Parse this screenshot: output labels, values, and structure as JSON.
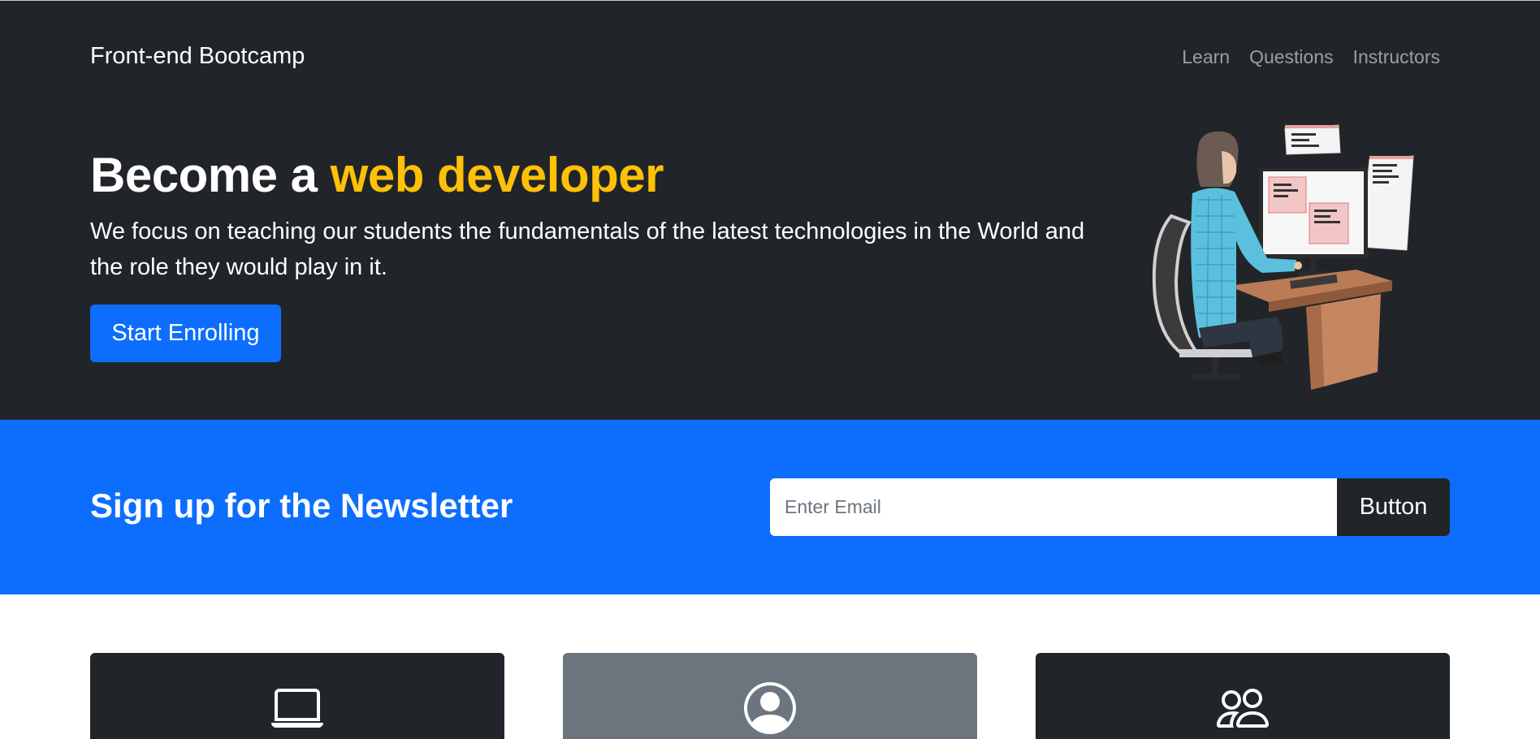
{
  "navbar": {
    "brand": "Front-end Bootcamp",
    "links": [
      {
        "label": "Learn"
      },
      {
        "label": "Questions"
      },
      {
        "label": "Instructors"
      }
    ]
  },
  "hero": {
    "title_prefix": "Become a ",
    "title_highlight": "web developer",
    "lead": "We focus on teaching our students the fundamentals of the latest technologies in the World and the role they would play in it.",
    "cta_label": "Start Enrolling",
    "illustration_icon": "woman-at-computer-illustration"
  },
  "newsletter": {
    "title": "Sign up for the Newsletter",
    "email_placeholder": "Enter Email",
    "email_value": "",
    "button_label": "Button"
  },
  "boxes": [
    {
      "icon": "laptop-icon",
      "style": "dark"
    },
    {
      "icon": "person-circle-icon",
      "style": "secondary"
    },
    {
      "icon": "people-icon",
      "style": "dark"
    }
  ],
  "colors": {
    "dark": "#212529",
    "primary": "#0d6efd",
    "warning": "#ffc107",
    "secondary": "#6c757d",
    "nav_link": "rgba(255,255,255,0.55)"
  }
}
